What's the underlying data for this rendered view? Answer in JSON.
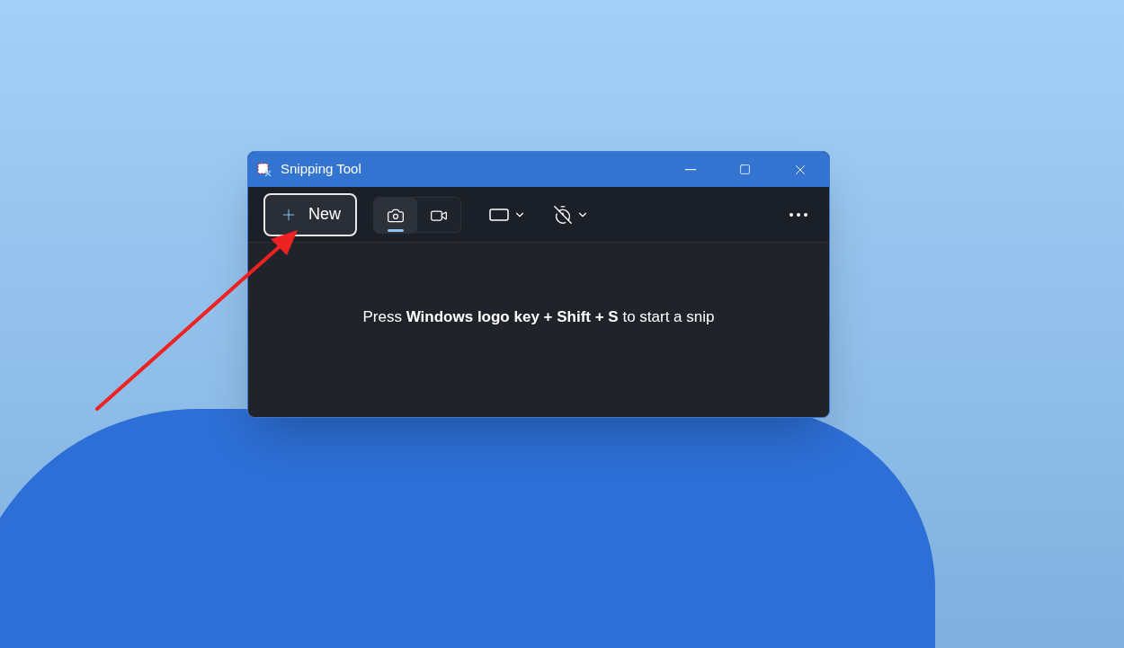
{
  "window": {
    "title": "Snipping Tool"
  },
  "toolbar": {
    "new_button": {
      "label": "New"
    },
    "capture_modes": [
      {
        "kind": "photo",
        "selected": true
      },
      {
        "kind": "video",
        "selected": false
      }
    ]
  },
  "hint": "Press **Windows logo key + Shift + S** to start a snip"
}
